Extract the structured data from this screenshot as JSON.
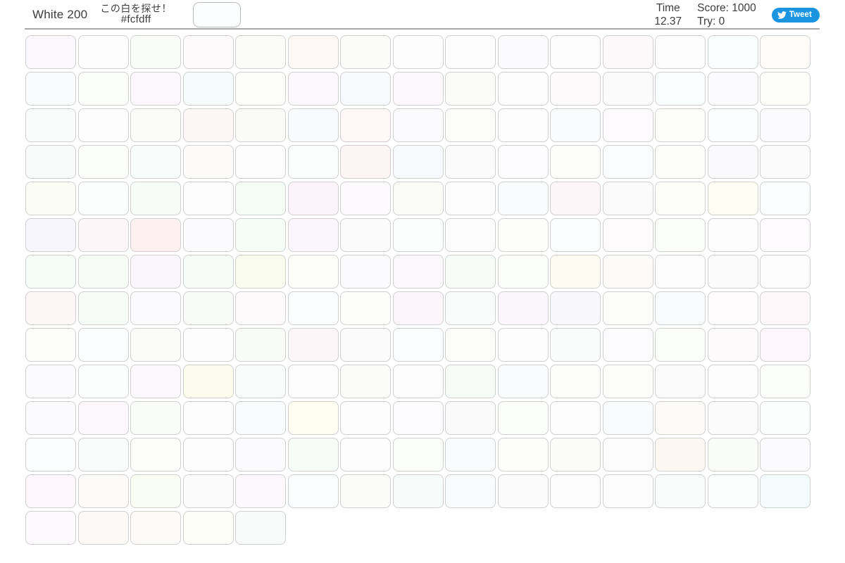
{
  "header": {
    "mode_label": "White 200",
    "target_prompt": "この白を探せ！",
    "target_hex": "#fcfdff",
    "target_swatch_color": "#fcfdff",
    "time_label": "Time",
    "time_value": "12.37",
    "score_label": "Score: 1000",
    "try_label": "Try: 0",
    "tweet_label": "Tweet",
    "tweet_button_color": "#1b95e0"
  },
  "grid": {
    "columns": 15,
    "rows": 14,
    "tile_count": 200,
    "target_color": "#fcfdff",
    "tiles": [
      "#faf8fd",
      "#fdfdfd",
      "#fafcfa",
      "#fdfafb",
      "#fbfbfa",
      "#fdf8f6",
      "#fbfcfa",
      "#fdfdfe",
      "#fdfdfd",
      "#fbfbfd",
      "#fdfcfd",
      "#fdf9fb",
      "#fcfcfc",
      "#f9fdfd",
      "#fefbf9",
      "#fafbfd",
      "#fbfdfb",
      "#fbf7fd",
      "#f6fbfc",
      "#fcfcfa",
      "#fbf9fd",
      "#f7f9fc",
      "#fdf8fb",
      "#fbfcfa",
      "#fcfcfd",
      "#fdfafc",
      "#fbfbfb",
      "#fafdfd",
      "#fbfbfd",
      "#fdfdfa",
      "#fafcfb",
      "#fcfdfc",
      "#fbfbf9",
      "#fdf6f7",
      "#fafbf9",
      "#f8fafd",
      "#fdf7f8",
      "#fbfafc",
      "#fcfcfb",
      "#fdfcfc",
      "#fafbfd",
      "#fdfbfd",
      "#fcfcfa",
      "#fafcfd",
      "#fbfafd",
      "#f9fbfa",
      "#fbfdfb",
      "#f8fdfc",
      "#fdfbfa",
      "#fcfcfc",
      "#fafdfb",
      "#fdf4f5",
      "#f8f9fd",
      "#fbfbfb",
      "#fcfbfd",
      "#fcfcfa",
      "#fbfcfd",
      "#fdfdfb",
      "#fafafc",
      "#fbfbfc",
      "#fbfdf4",
      "#fcfdfd",
      "#f8fcf9",
      "#fbfcfb",
      "#f5fbf5",
      "#fdf4fa",
      "#fcfafd",
      "#fbfbf8",
      "#fcfdfc",
      "#fafbfd",
      "#fdf5f8",
      "#fbfbfb",
      "#fdfdfa",
      "#fdfdf3",
      "#fafcfd",
      "#f8f6fd",
      "#fdf6f9",
      "#fcf1f0",
      "#fbfbfd",
      "#f6fcf7",
      "#faf6fd",
      "#fbfbfb",
      "#fcfdfd",
      "#fbfcfb",
      "#fdfdfc",
      "#fafcfd",
      "#fdfbfb",
      "#fbfdfb",
      "#fcfcfc",
      "#fdfbfd",
      "#f6fdf8",
      "#f7fbf6",
      "#f9f6fd",
      "#f8fcf8",
      "#fafbef",
      "#fdfdfa",
      "#fbfbfd",
      "#fbf8fb",
      "#f8fcf8",
      "#fbfdfb",
      "#fcfcf2",
      "#fdfbfa",
      "#fcfcfd",
      "#fbfbfb",
      "#fdfcfd",
      "#fdf6f7",
      "#f7fbf8",
      "#fbfbfd",
      "#f8fbf8",
      "#fdfafb",
      "#fbfcfd",
      "#fdfdfb",
      "#fcf6fb",
      "#fafcfb",
      "#fbf6fb",
      "#f7f7fc",
      "#fdfdfc",
      "#fafbfd",
      "#fdfbfb",
      "#fdf7fa",
      "#fcfcfb",
      "#fbfcfd",
      "#fbfbfa",
      "#fcfdfc",
      "#f9fbf8",
      "#fdf6f8",
      "#fbfbfb",
      "#fbfcfd",
      "#fcfcfa",
      "#fdfdfd",
      "#fafbfb",
      "#fcfbfd",
      "#fbfdfb",
      "#fdfafc",
      "#fdf6fa",
      "#fbfbfd",
      "#fcfdfd",
      "#fbf9fd",
      "#fbfbee",
      "#fafbfb",
      "#fdfcfc",
      "#fbfcfa",
      "#fcfcfd",
      "#f7fbf7",
      "#fafbfd",
      "#fcfcfb",
      "#fdfdfc",
      "#fbfbfb",
      "#fcfcfd",
      "#fbfdfb",
      "#fbfbfd",
      "#fbf7fb",
      "#fafcfa",
      "#fcfcfd",
      "#fafbfd",
      "#fdfdf2",
      "#fbfcfb",
      "#fcfbfd",
      "#fafafb",
      "#fbfdfb",
      "#fcfcfc",
      "#fafbfd",
      "#fdfbfa",
      "#fbfbfb",
      "#fcfdfd",
      "#fbfcfd",
      "#fafbfb",
      "#fcfcfa",
      "#fdfcfd",
      "#fbfbfd",
      "#f8fcf9",
      "#fcfcfc",
      "#fbfdfb",
      "#fafbfd",
      "#fdfdfb",
      "#fbfbfa",
      "#fcfcfd",
      "#fdf7f2",
      "#fafcfa",
      "#fbfbfd",
      "#fdf6fa",
      "#fdfafa",
      "#fafdf3",
      "#fbfbfb",
      "#fdf8fb",
      "#fafcfd",
      "#fbfbfa",
      "#f7fcfb",
      "#fafbfd",
      "#fcfbfc",
      "#fbfcfb",
      "#fdfdfd",
      "#fafbfb",
      "#fbfdfd",
      "#f3fbfd",
      "#fdfafd",
      "#fdf9f7",
      "#fdfafa",
      "#fbfdf6",
      "#f9fafa"
    ]
  }
}
